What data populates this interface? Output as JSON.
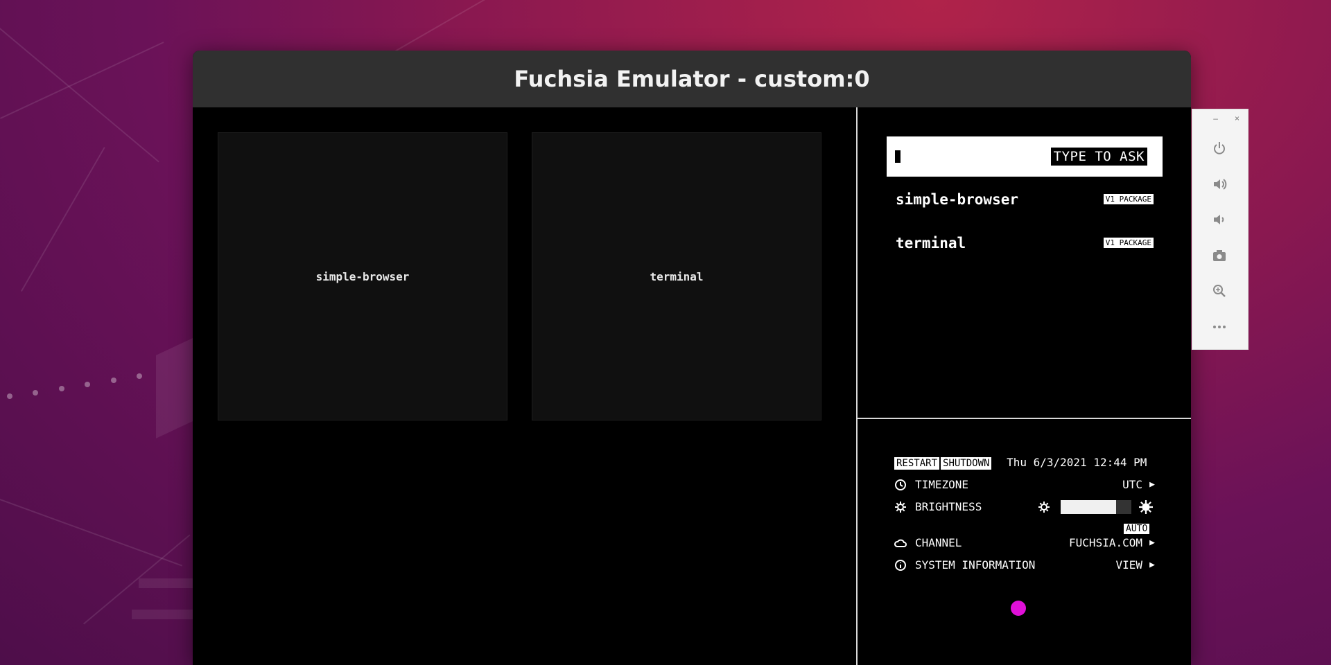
{
  "window": {
    "title": "Fuchsia Emulator - custom:0"
  },
  "tiles": [
    {
      "label": "simple-browser"
    },
    {
      "label": "terminal"
    }
  ],
  "ask": {
    "placeholder": "TYPE TO ASK"
  },
  "packages": [
    {
      "name": "simple-browser",
      "badge": "V1 PACKAGE"
    },
    {
      "name": "terminal",
      "badge": "V1 PACKAGE"
    }
  ],
  "system": {
    "restart_label": "RESTART",
    "shutdown_label": "SHUTDOWN",
    "datetime": "Thu 6/3/2021 12:44 PM",
    "timezone": {
      "label": "TIMEZONE",
      "value": "UTC",
      "icon": "clock-icon"
    },
    "brightness": {
      "label": "BRIGHTNESS",
      "level": 0.78,
      "icon": "sun-icon"
    },
    "auto_label": "AUTO",
    "channel": {
      "label": "CHANNEL",
      "value": "FUCHSIA.COM",
      "icon": "cloud-icon"
    },
    "system_info": {
      "label": "SYSTEM INFORMATION",
      "value": "VIEW",
      "icon": "info-icon"
    }
  },
  "emulator_controls": {
    "minimize_label": "–",
    "close_label": "×",
    "icons": [
      "power-icon",
      "volume-up-icon",
      "volume-down-icon",
      "camera-icon",
      "zoom-icon",
      "more-icon"
    ]
  },
  "colors": {
    "touch_indicator": "#e010d8",
    "titlebar": "#303030"
  }
}
